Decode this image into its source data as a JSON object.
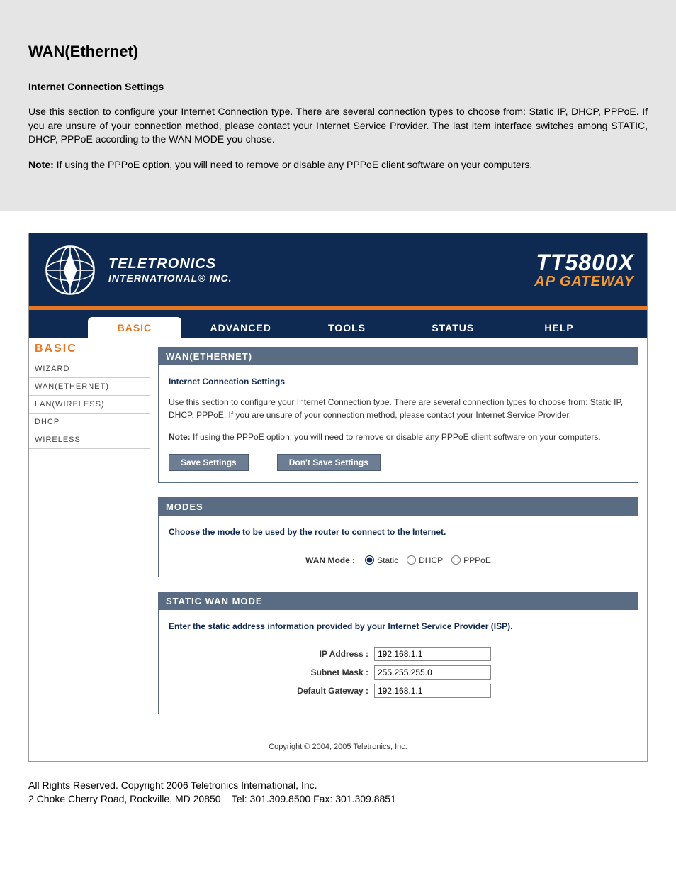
{
  "doc": {
    "title": "WAN(Ethernet)",
    "subheading": "Internet Connection Settings",
    "para1": "Use this section to configure your Internet Connection type. There are several connection types to choose from: Static IP, DHCP, PPPoE. If you are unsure of your connection method, please contact your Internet Service Provider. The last item interface switches among STATIC, DHCP, PPPoE according to the WAN MODE you chose.",
    "note_label": "Note:",
    "note_text": " If using the PPPoE option, you will need to remove or disable any PPPoE client software on your computers."
  },
  "header": {
    "brand_line1": "TELETRONICS",
    "brand_line2": "INTERNATIONAL® INC.",
    "model": "TT5800X",
    "subtitle": "AP GATEWAY"
  },
  "tabs": [
    "BASIC",
    "ADVANCED",
    "TOOLS",
    "STATUS",
    "HELP"
  ],
  "sidebar": {
    "title": "BASIC",
    "items": [
      "WIZARD",
      "WAN(ETHERNET)",
      "LAN(WIRELESS)",
      "DHCP",
      "WIRELESS"
    ]
  },
  "panel_wan": {
    "header": "WAN(ETHERNET)",
    "sub_title": "Internet Connection Settings",
    "para1": "Use this section to configure your Internet Connection type. There are several connection types to choose from: Static IP, DHCP, PPPoE. If you are unsure of your connection method, please contact your Internet Service Provider.",
    "note_label": "Note:",
    "note_text": " If using the PPPoE option, you will need to remove or disable any PPPoE client software on your computers.",
    "btn_save": "Save Settings",
    "btn_cancel": "Don't Save Settings"
  },
  "panel_modes": {
    "header": "MODES",
    "desc": "Choose the mode to be used by the router to connect to the Internet.",
    "label": "WAN Mode :",
    "options": [
      "Static",
      "DHCP",
      "PPPoE"
    ],
    "selected": "Static"
  },
  "panel_static": {
    "header": "STATIC WAN MODE",
    "desc": "Enter the static address information provided by your Internet Service Provider (ISP).",
    "fields": [
      {
        "label": "IP Address :",
        "value": "192.168.1.1"
      },
      {
        "label": "Subnet Mask :",
        "value": "255.255.255.0"
      },
      {
        "label": "Default Gateway :",
        "value": "192.168.1.1"
      }
    ]
  },
  "copyright": "Copyright © 2004, 2005 Teletronics, Inc.",
  "footer": {
    "line1": "All Rights Reserved. Copyright 2006 Teletronics International, Inc.",
    "line2": "2 Choke Cherry Road, Rockville, MD 20850    Tel: 301.309.8500 Fax: 301.309.8851"
  }
}
